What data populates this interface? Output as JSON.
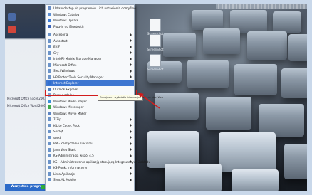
{
  "colors": {
    "frame": "#c9d8ea",
    "highlight": "#3d76d1",
    "callout": "#d21d1d",
    "all_programs_bar": "#2c6ac8"
  },
  "left_pane": {
    "labels": [
      "Microsoft Office Excel 2007",
      "Microsoft Office Word 2007"
    ],
    "all_programs": "Wszystkie programy"
  },
  "programs_menu": {
    "items": [
      {
        "label": "Ustaw dostęp do programów i ich ustawienia domyślne",
        "icon": "program-defaults-icon",
        "arrow": false,
        "color": "#6a8fc7"
      },
      {
        "label": "Windows Catalog",
        "icon": "catalog-icon",
        "arrow": false,
        "color": "#5f8fd1"
      },
      {
        "label": "Windows Update",
        "icon": "windows-update-icon",
        "arrow": false,
        "color": "#3c7bd6"
      },
      {
        "label": "Plug-in do Bluetooth",
        "icon": "bluetooth-icon",
        "arrow": false,
        "color": "#3a62b8"
      },
      {
        "sep": true
      },
      {
        "label": "Akcesoria",
        "icon": "folder-icon",
        "arrow": true,
        "color": "#6b93c9"
      },
      {
        "label": "Autostart",
        "icon": "folder-icon",
        "arrow": true,
        "color": "#6b93c9"
      },
      {
        "label": "EXIF",
        "icon": "folder-icon",
        "arrow": true,
        "color": "#6b93c9"
      },
      {
        "label": "Gry",
        "icon": "folder-icon",
        "arrow": true,
        "color": "#6b93c9"
      },
      {
        "label": "Intel(R) Matrix Storage Manager",
        "icon": "folder-icon",
        "arrow": true,
        "color": "#6b93c9"
      },
      {
        "label": "Microsoft Office",
        "icon": "folder-icon",
        "arrow": true,
        "color": "#6b93c9"
      },
      {
        "label": "Sieci Windows",
        "icon": "folder-icon",
        "arrow": true,
        "color": "#6b93c9"
      },
      {
        "label": "HP ProtectTools Security Manager",
        "icon": "folder-icon",
        "arrow": true,
        "color": "#6b93c9"
      },
      {
        "label": "Internet Explorer",
        "icon": "internet-explorer-icon",
        "arrow": false,
        "color": "#2f6fd0",
        "highlighted": true
      },
      {
        "label": "Outlook Express",
        "icon": "outlook-express-icon",
        "arrow": false,
        "color": "#4d7fc4"
      },
      {
        "label": "Pomoc zdalna",
        "icon": "remote-assistance-icon",
        "arrow": false,
        "color": "#7aa2d4"
      },
      {
        "label": "Windows Media Player",
        "icon": "media-player-icon",
        "arrow": false,
        "color": "#3b8fd9"
      },
      {
        "label": "Windows Messenger",
        "icon": "messenger-icon",
        "arrow": false,
        "color": "#3faa4a"
      },
      {
        "label": "Windows Movie Maker",
        "icon": "movie-maker-icon",
        "arrow": false,
        "color": "#5d84c2"
      },
      {
        "label": "7-Zip",
        "icon": "folder-icon",
        "arrow": true,
        "color": "#6b93c9"
      },
      {
        "label": "K-Lite Codec Pack",
        "icon": "folder-icon",
        "arrow": true,
        "color": "#6b93c9"
      },
      {
        "label": "Sprzęt",
        "icon": "folder-icon",
        "arrow": true,
        "color": "#6b93c9"
      },
      {
        "label": "spod",
        "icon": "folder-icon",
        "arrow": true,
        "color": "#6b93c9"
      },
      {
        "label": "PM - Zarządzanie sieciami",
        "icon": "folder-icon",
        "arrow": true,
        "color": "#6b93c9"
      },
      {
        "label": "Java Web Start",
        "icon": "folder-icon",
        "arrow": true,
        "color": "#6b93c9"
      },
      {
        "label": "KS-Administracja wspól 4.5",
        "icon": "folder-icon",
        "arrow": true,
        "color": "#6b93c9"
      },
      {
        "label": "KS - Administrowanie aplikacją stosującą Integrowanych Zakładu",
        "icon": "folder-icon",
        "arrow": true,
        "color": "#6b93c9"
      },
      {
        "label": "KS-Punkt Informacyjny",
        "icon": "folder-icon",
        "arrow": true,
        "color": "#6b93c9"
      },
      {
        "label": "Linia Aplikacje",
        "icon": "folder-icon",
        "arrow": true,
        "color": "#6b93c9"
      },
      {
        "label": "SyncML Mobile",
        "icon": "folder-icon",
        "arrow": true,
        "color": "#6b93c9"
      }
    ]
  },
  "tooltip": {
    "text": "Odnajduje i wyświetla informacje i witryny sieci Web"
  },
  "desktop_icons": [
    {
      "label": "Screenshot"
    },
    {
      "label": "ScreenShot"
    },
    {
      "label": "ScreenShot"
    }
  ]
}
